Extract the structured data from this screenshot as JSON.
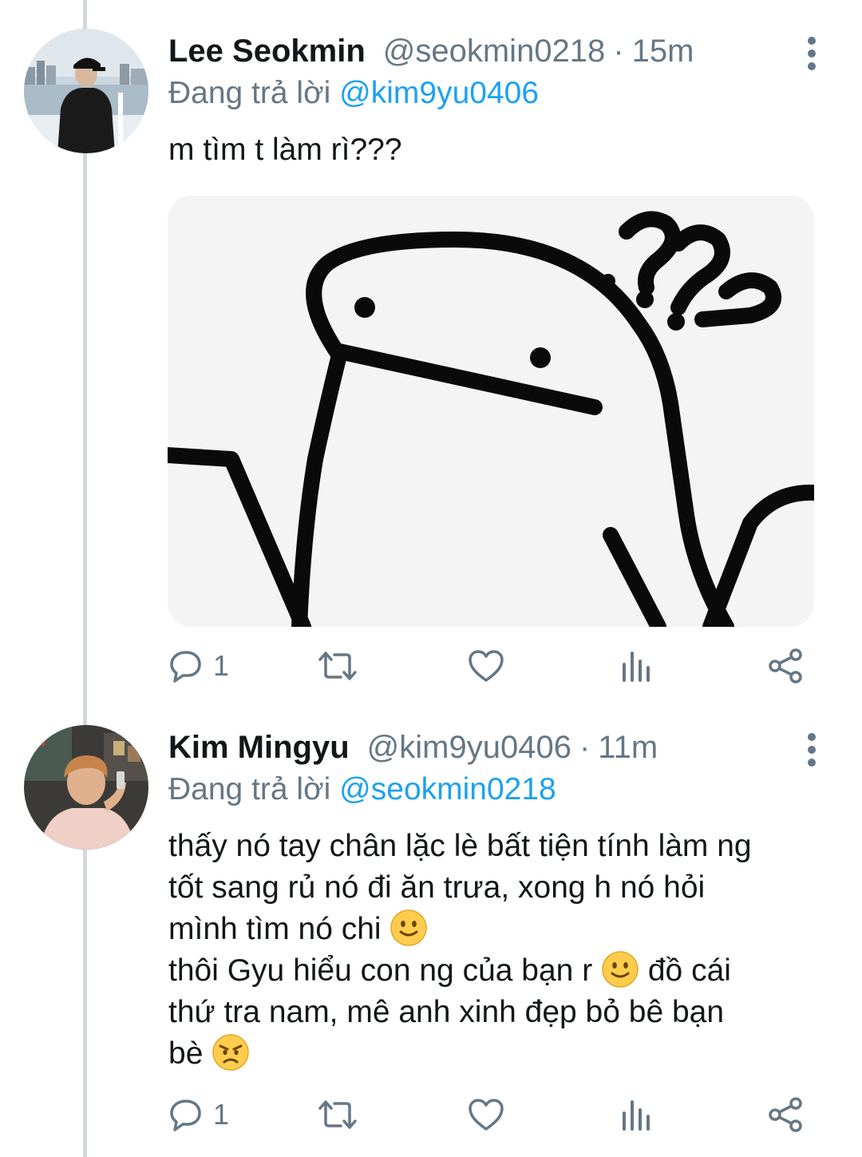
{
  "tweets": [
    {
      "author": {
        "name": "Lee Seokmin",
        "handle": "@seokmin0218"
      },
      "time": "15m",
      "reply_prefix": "Đang trả lời",
      "reply_to": "@kim9yu0406",
      "text": "m tìm t làm rì???",
      "media": {
        "type": "image",
        "description_icon": "confused-blob-meme"
      },
      "actions": {
        "reply_count": "1"
      }
    },
    {
      "author": {
        "name": "Kim Mingyu",
        "handle": "@kim9yu0406"
      },
      "time": "11m",
      "reply_prefix": "Đang trả lời",
      "reply_to": "@seokmin0218",
      "text_parts": [
        "thấy nó tay chân lặc lè bất tiện tính làm ng\ntốt sang rủ nó đi ăn trưa, xong h nó hỏi\nmình tìm nó chi ",
        "\nthôi Gyu hiểu con ng của bạn r ",
        " đồ cái\nthứ tra nam, mê anh xinh đẹp bỏ bê bạn\nbè "
      ],
      "actions": {
        "reply_count": "1"
      }
    }
  ],
  "separator": "·",
  "colors": {
    "accent": "#1da1f2",
    "secondary_text": "#657786",
    "thread_line": "#cfd9de"
  },
  "icons": [
    "reply-icon",
    "retweet-icon",
    "like-icon",
    "analytics-icon",
    "share-icon",
    "more-icon",
    "slightly-smiling-emoji",
    "angry-emoji"
  ]
}
